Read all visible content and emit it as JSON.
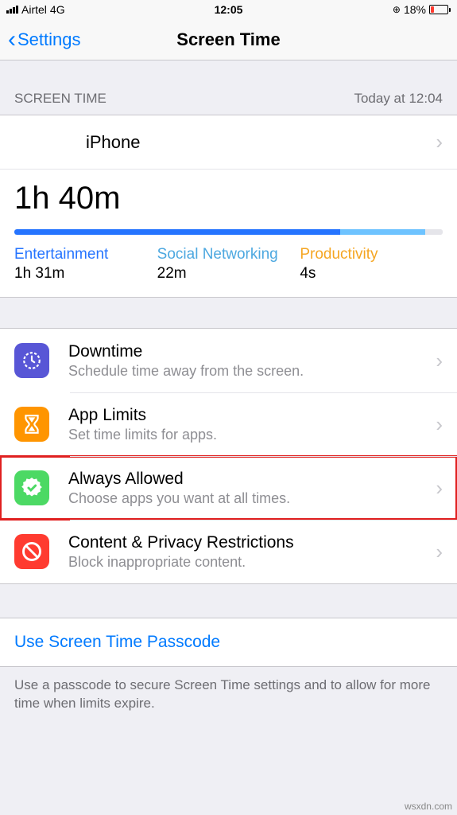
{
  "status": {
    "carrier": "Airtel",
    "network": "4G",
    "time": "12:05",
    "battery_pct": "18%"
  },
  "nav": {
    "back_label": "Settings",
    "title": "Screen Time"
  },
  "summary": {
    "header_left": "SCREEN TIME",
    "header_right": "Today at 12:04",
    "device": "iPhone",
    "total": "1h 40m",
    "categories": [
      {
        "name": "Entertainment",
        "time": "1h 31m"
      },
      {
        "name": "Social Networking",
        "time": "22m"
      },
      {
        "name": "Productivity",
        "time": "4s"
      }
    ]
  },
  "options": {
    "downtime_title": "Downtime",
    "downtime_sub": "Schedule time away from the screen.",
    "applimits_title": "App Limits",
    "applimits_sub": "Set time limits for apps.",
    "always_title": "Always Allowed",
    "always_sub": "Choose apps you want at all times.",
    "content_title": "Content & Privacy Restrictions",
    "content_sub": "Block inappropriate content."
  },
  "passcode": {
    "link": "Use Screen Time Passcode",
    "footer": "Use a passcode to secure Screen Time settings and to allow for more time when limits expire."
  },
  "watermark": "wsxdn.com",
  "chart_data": {
    "type": "bar",
    "title": "Screen Time usage",
    "categories": [
      "Entertainment",
      "Social Networking",
      "Productivity"
    ],
    "values_minutes": [
      91,
      22,
      0.07
    ],
    "total_minutes": 100,
    "colors": [
      "#2574ff",
      "#6ec3ff",
      "#f5a623"
    ]
  }
}
